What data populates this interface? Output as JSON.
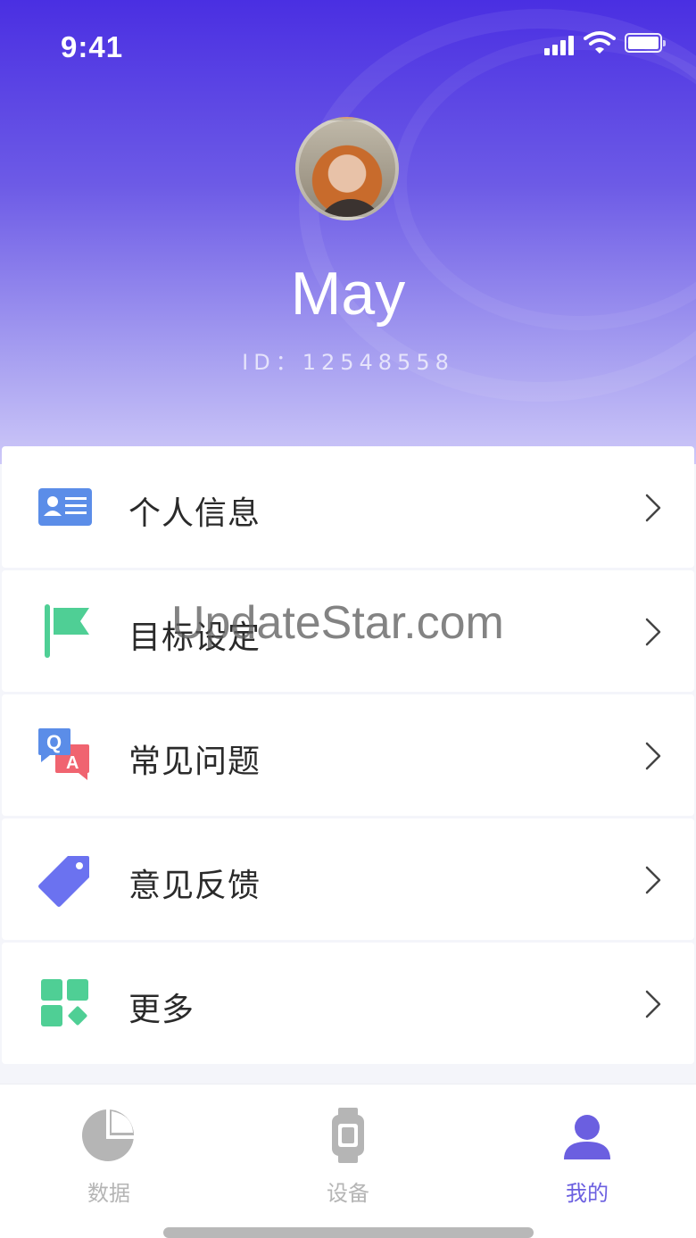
{
  "status_bar": {
    "time": "9:41"
  },
  "profile": {
    "name": "May",
    "id_text": "ID：12548558"
  },
  "menu": {
    "items": [
      {
        "label": "个人信息",
        "icon": "id-card-icon",
        "color": "#5b8de8"
      },
      {
        "label": "目标设定",
        "icon": "flag-icon",
        "color": "#4fcf95"
      },
      {
        "label": "常见问题",
        "icon": "qa-icon",
        "color": "#f06470"
      },
      {
        "label": "意见反馈",
        "icon": "tag-icon",
        "color": "#6b72f0"
      },
      {
        "label": "更多",
        "icon": "grid-icon",
        "color": "#4fcf95"
      }
    ]
  },
  "watermark": "UpdateStar.com",
  "tabbar": {
    "tabs": [
      {
        "label": "数据",
        "icon": "pie-chart-icon",
        "active": false
      },
      {
        "label": "设备",
        "icon": "watch-icon",
        "active": false
      },
      {
        "label": "我的",
        "icon": "user-icon",
        "active": true
      }
    ],
    "accent": "#6b5fe0",
    "inactive_color": "#b5b5b5"
  }
}
